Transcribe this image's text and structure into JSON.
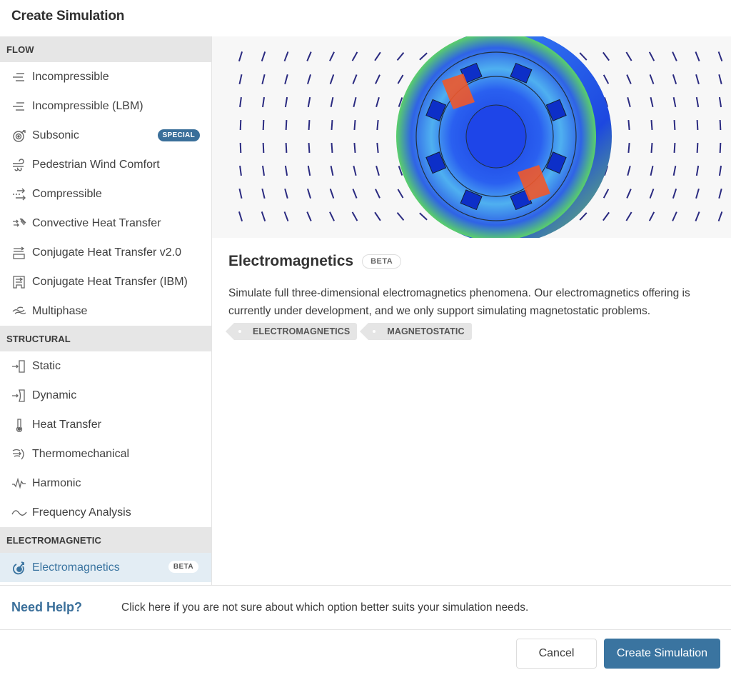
{
  "dialog": {
    "title": "Create Simulation"
  },
  "sidebar": {
    "sections": [
      {
        "header": "FLOW",
        "items": [
          {
            "label": "Incompressible",
            "icon": "flow-lines-icon"
          },
          {
            "label": "Incompressible (LBM)",
            "icon": "flow-lines-icon"
          },
          {
            "label": "Subsonic",
            "icon": "subsonic-icon",
            "badge": "SPECIAL"
          },
          {
            "label": "Pedestrian Wind Comfort",
            "icon": "wind-icon"
          },
          {
            "label": "Compressible",
            "icon": "compressible-arrows-icon"
          },
          {
            "label": "Convective Heat Transfer",
            "icon": "convective-heat-icon"
          },
          {
            "label": "Conjugate Heat Transfer v2.0",
            "icon": "conjugate-heat-icon"
          },
          {
            "label": "Conjugate Heat Transfer (IBM)",
            "icon": "conjugate-heat-ibm-icon"
          },
          {
            "label": "Multiphase",
            "icon": "multiphase-waves-icon"
          }
        ]
      },
      {
        "header": "STRUCTURAL",
        "items": [
          {
            "label": "Static",
            "icon": "static-load-icon"
          },
          {
            "label": "Dynamic",
            "icon": "dynamic-load-icon"
          },
          {
            "label": "Heat Transfer",
            "icon": "thermometer-icon"
          },
          {
            "label": "Thermomechanical",
            "icon": "thermomechanical-icon"
          },
          {
            "label": "Harmonic",
            "icon": "harmonic-wave-icon"
          },
          {
            "label": "Frequency Analysis",
            "icon": "sine-wave-icon"
          }
        ]
      },
      {
        "header": "ELECTROMAGNETIC",
        "items": [
          {
            "label": "Electromagnetics",
            "icon": "electromagnetics-icon",
            "badge": "BETA",
            "selected": true
          }
        ]
      }
    ]
  },
  "detail": {
    "title": "Electromagnetics",
    "badge": "BETA",
    "description": "Simulate full three-dimensional electromagnetics phenomena. Our electromagnetics offering is currently under development, and we only support simulating magnetostatic problems.",
    "tags": [
      "ELECTROMAGNETICS",
      "MAGNETOSTATIC"
    ],
    "preview_image": "electromagnetic motor field simulation with vector arrows"
  },
  "help": {
    "title": "Need Help?",
    "text": "Click here if you are not sure about which option better suits your simulation needs."
  },
  "footer": {
    "cancel_label": "Cancel",
    "create_label": "Create Simulation"
  },
  "colors": {
    "accent": "#3a74a0",
    "special_badge": "#3a6f9a",
    "selected_bg": "#e3edf4",
    "section_header_bg": "#e6e6e6"
  }
}
